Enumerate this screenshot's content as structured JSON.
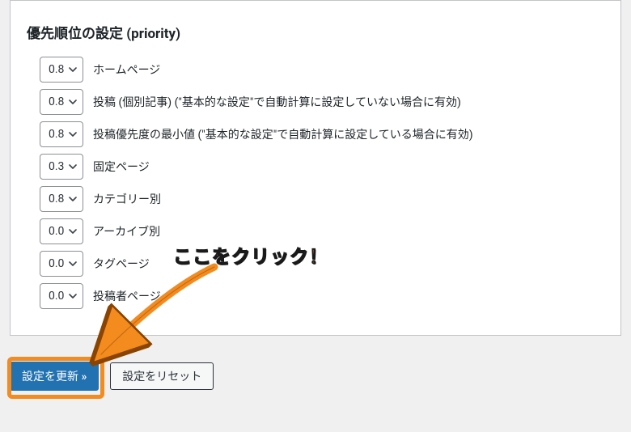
{
  "panel": {
    "title": "優先順位の設定 (priority)",
    "rows": [
      {
        "value": "0.8",
        "label": "ホームページ"
      },
      {
        "value": "0.8",
        "label": "投稿 (個別記事) (\"基本的な設定\"で自動計算に設定していない場合に有効)"
      },
      {
        "value": "0.8",
        "label": "投稿優先度の最小値 (\"基本的な設定\"で自動計算に設定している場合に有効)"
      },
      {
        "value": "0.3",
        "label": "固定ページ"
      },
      {
        "value": "0.8",
        "label": "カテゴリー別"
      },
      {
        "value": "0.0",
        "label": "アーカイブ別"
      },
      {
        "value": "0.0",
        "label": "タグページ"
      },
      {
        "value": "0.0",
        "label": "投稿者ページ"
      }
    ]
  },
  "actions": {
    "update": "設定を更新 »",
    "reset": "設定をリセット"
  },
  "annotation": {
    "text": "ここをクリック！"
  },
  "colors": {
    "accent_orange": "#f38b1e",
    "primary_blue": "#2271b1"
  }
}
